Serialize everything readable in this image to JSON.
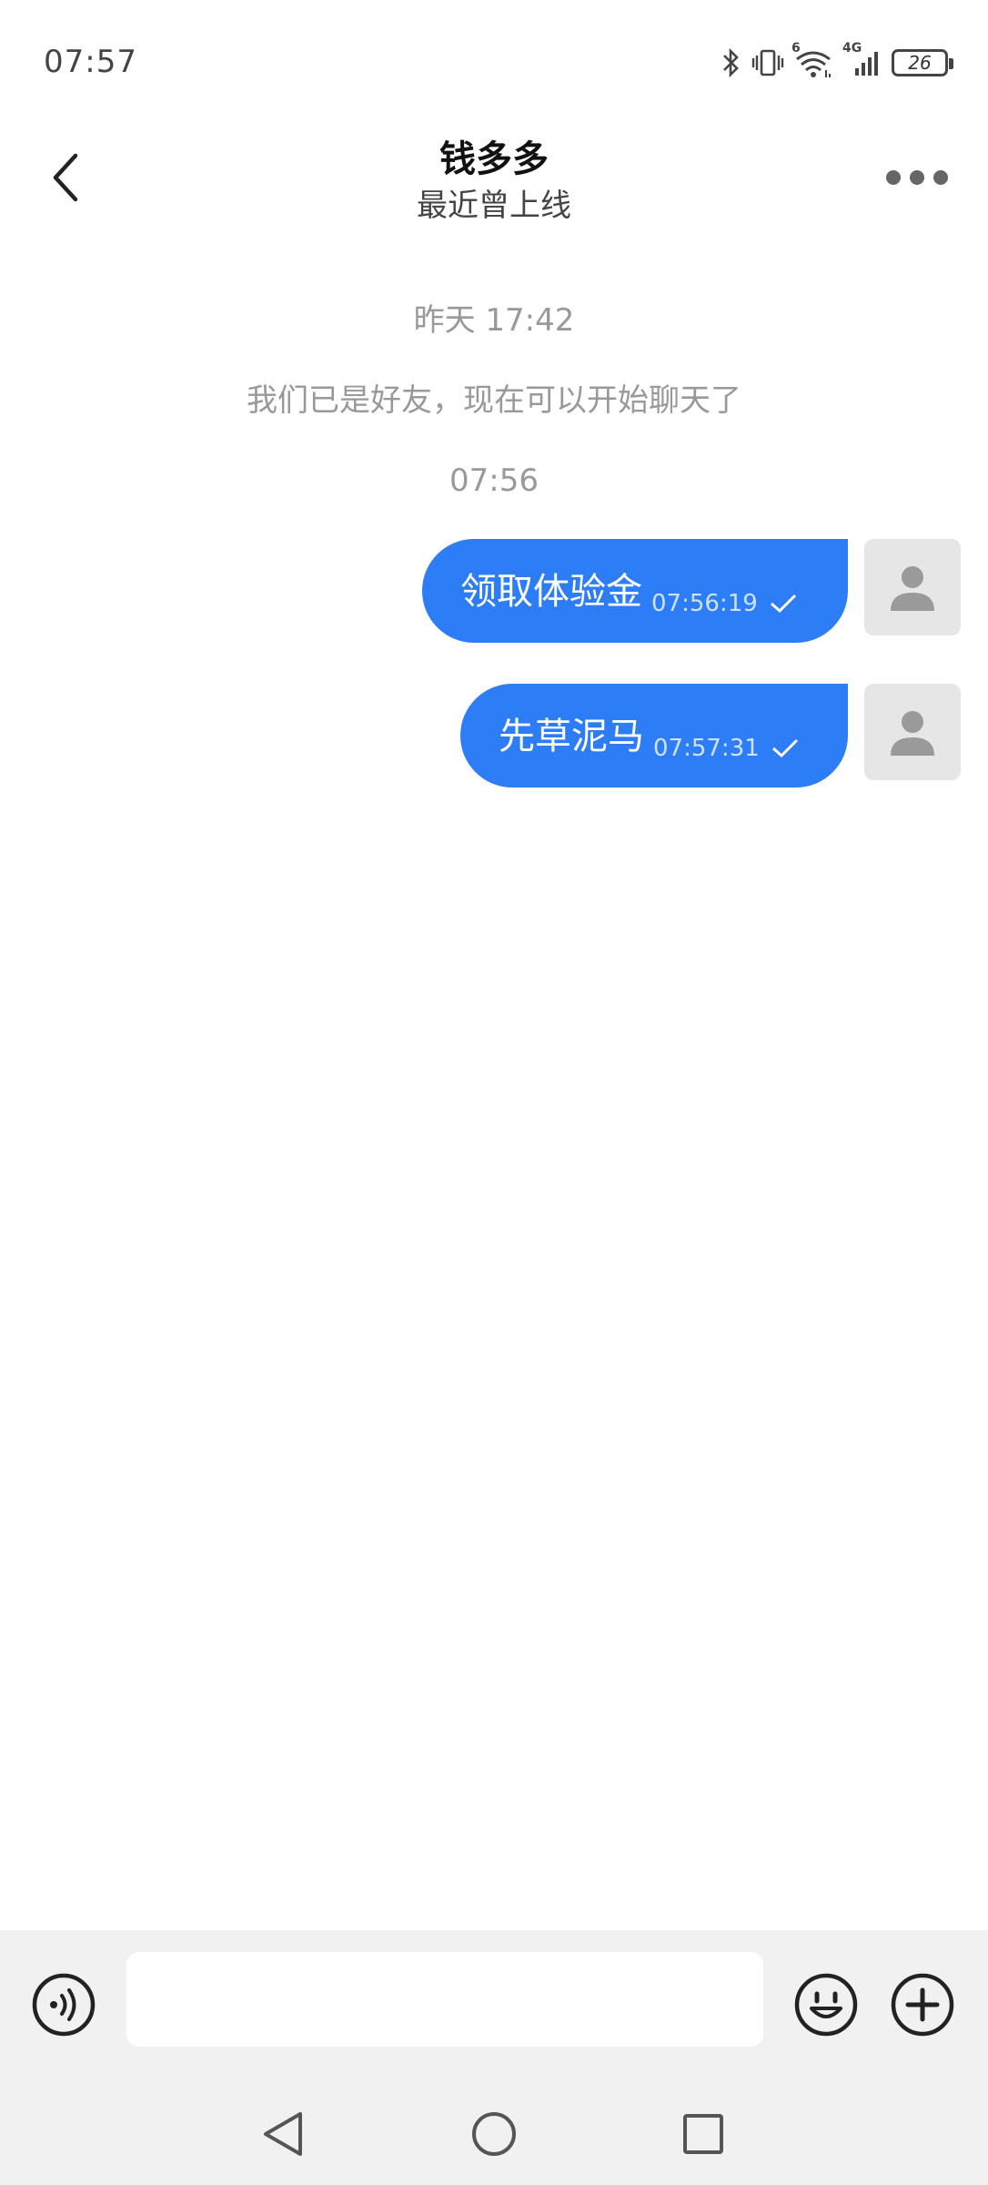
{
  "status_bar": {
    "time": "07:57",
    "signal_label_wifi": "6",
    "signal_label_cell": "4G",
    "battery": "26"
  },
  "header": {
    "title": "钱多多",
    "subtitle": "最近曾上线"
  },
  "chat": {
    "date_divider": "昨天 17:42",
    "system_note": "我们已是好友，现在可以开始聊天了",
    "time_divider": "07:56",
    "messages": [
      {
        "text": "领取体验金",
        "time": "07:56:19",
        "status": "sent"
      },
      {
        "text": "先草泥马",
        "time": "07:57:31",
        "status": "sent"
      }
    ]
  },
  "input_bar": {
    "placeholder": ""
  },
  "colors": {
    "accent": "#2c7df6",
    "background": "#ffffff",
    "bar_background": "#f1f1f1"
  }
}
